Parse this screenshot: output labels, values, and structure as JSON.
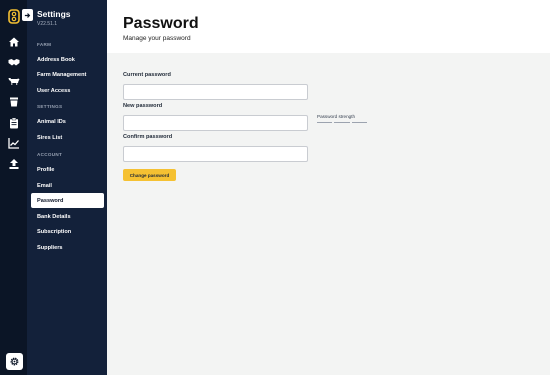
{
  "app": {
    "title": "Settings",
    "version": "V22.51.1"
  },
  "rail": {
    "icons": [
      "home-icon",
      "handshake-icon",
      "cow-icon",
      "bucket-icon",
      "clipboard-icon",
      "chart-icon",
      "upload-icon"
    ],
    "settings_icon": "gear-icon"
  },
  "sidebar": {
    "sections": [
      {
        "label": "FARM",
        "items": [
          "Address Book",
          "Farm Management",
          "User Access"
        ]
      },
      {
        "label": "SETTINGS",
        "items": [
          "Animal IDs",
          "Sires List"
        ]
      },
      {
        "label": "ACCOUNT",
        "items": [
          "Profile",
          "Email",
          "Password",
          "Bank Details",
          "Subscription",
          "Suppliers"
        ]
      }
    ],
    "active_item": "Password"
  },
  "page": {
    "title": "Password",
    "subtitle": "Manage your password"
  },
  "form": {
    "current_label": "Current password",
    "current_value": "",
    "new_label": "New password",
    "new_value": "",
    "confirm_label": "Confirm password",
    "confirm_value": "",
    "strength_label": "Password strength",
    "strength_level": 0,
    "submit_label": "Change password"
  },
  "colors": {
    "rail_bg": "#0b1526",
    "sidebar_bg": "#13213a",
    "accent": "#f5c132",
    "main_bg": "#f3f4f3"
  }
}
